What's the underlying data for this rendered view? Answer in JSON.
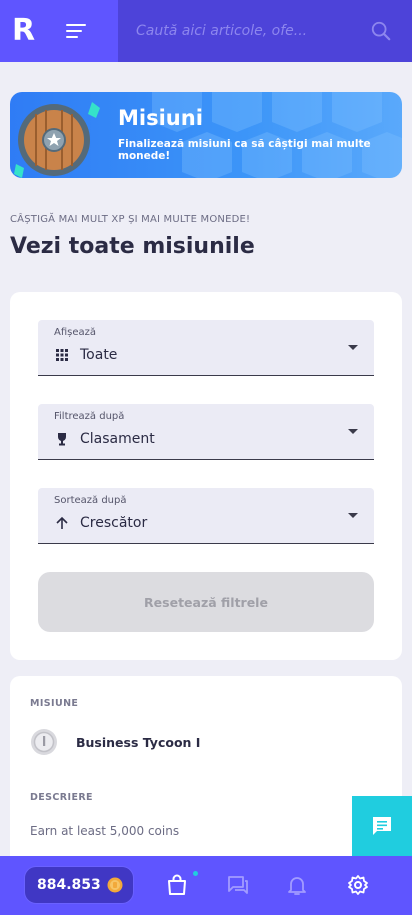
{
  "header": {
    "logo": "R",
    "search_placeholder": "Caută aici articole, ofe..."
  },
  "banner": {
    "title": "Misiuni",
    "subtitle": "Finalizează misiuni ca să câștigi mai multe monede!"
  },
  "page": {
    "kicker": "CÂȘTIGĂ MAI MULT XP ȘI MAI MULTE MONEDE!",
    "title": "Vezi toate misiunile"
  },
  "filters": {
    "show": {
      "label": "Afișează",
      "value": "Toate",
      "icon": "grid-icon"
    },
    "filter_by": {
      "label": "Filtrează după",
      "value": "Clasament",
      "icon": "trophy-icon"
    },
    "sort_by": {
      "label": "Sortează după",
      "value": "Crescător",
      "icon": "arrow-up-icon"
    },
    "reset_label": "Resetează filtrele"
  },
  "mission": {
    "section_label": "MISIUNE",
    "name": "Business Tycoon I",
    "description_label": "DESCRIERE",
    "description": "Earn at least 5,000 coins"
  },
  "bottom_nav": {
    "coins": "884.853",
    "items": [
      "shopping-bag-icon",
      "chat-icon",
      "bell-icon",
      "gear-icon"
    ]
  },
  "colors": {
    "primary": "#5f55ff",
    "search_bg": "#4d43d9",
    "chat_fab": "#20cddf",
    "banner": "#3c95f8"
  }
}
